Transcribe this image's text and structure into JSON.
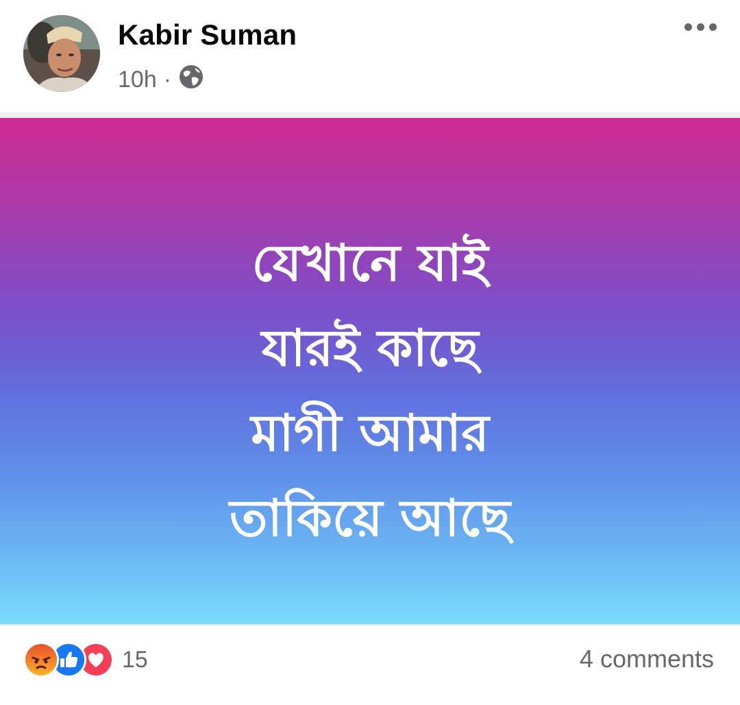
{
  "post": {
    "author": "Kabir Suman",
    "time": "10h",
    "separator": "·",
    "privacy_icon": "globe-icon",
    "menu_icon": "more-horizontal-icon",
    "content_lines": [
      "যেখানে যাই",
      "যারই কাছে",
      "মাগী আমার",
      "তাকিয়ে আছে"
    ],
    "background_colors": [
      "#cd2a90",
      "#7b4fc9",
      "#78dcfc"
    ]
  },
  "footer": {
    "reaction_icons": [
      "angry-reaction-icon",
      "like-reaction-icon",
      "love-reaction-icon"
    ],
    "reaction_count": "15",
    "comments": "4 comments"
  }
}
